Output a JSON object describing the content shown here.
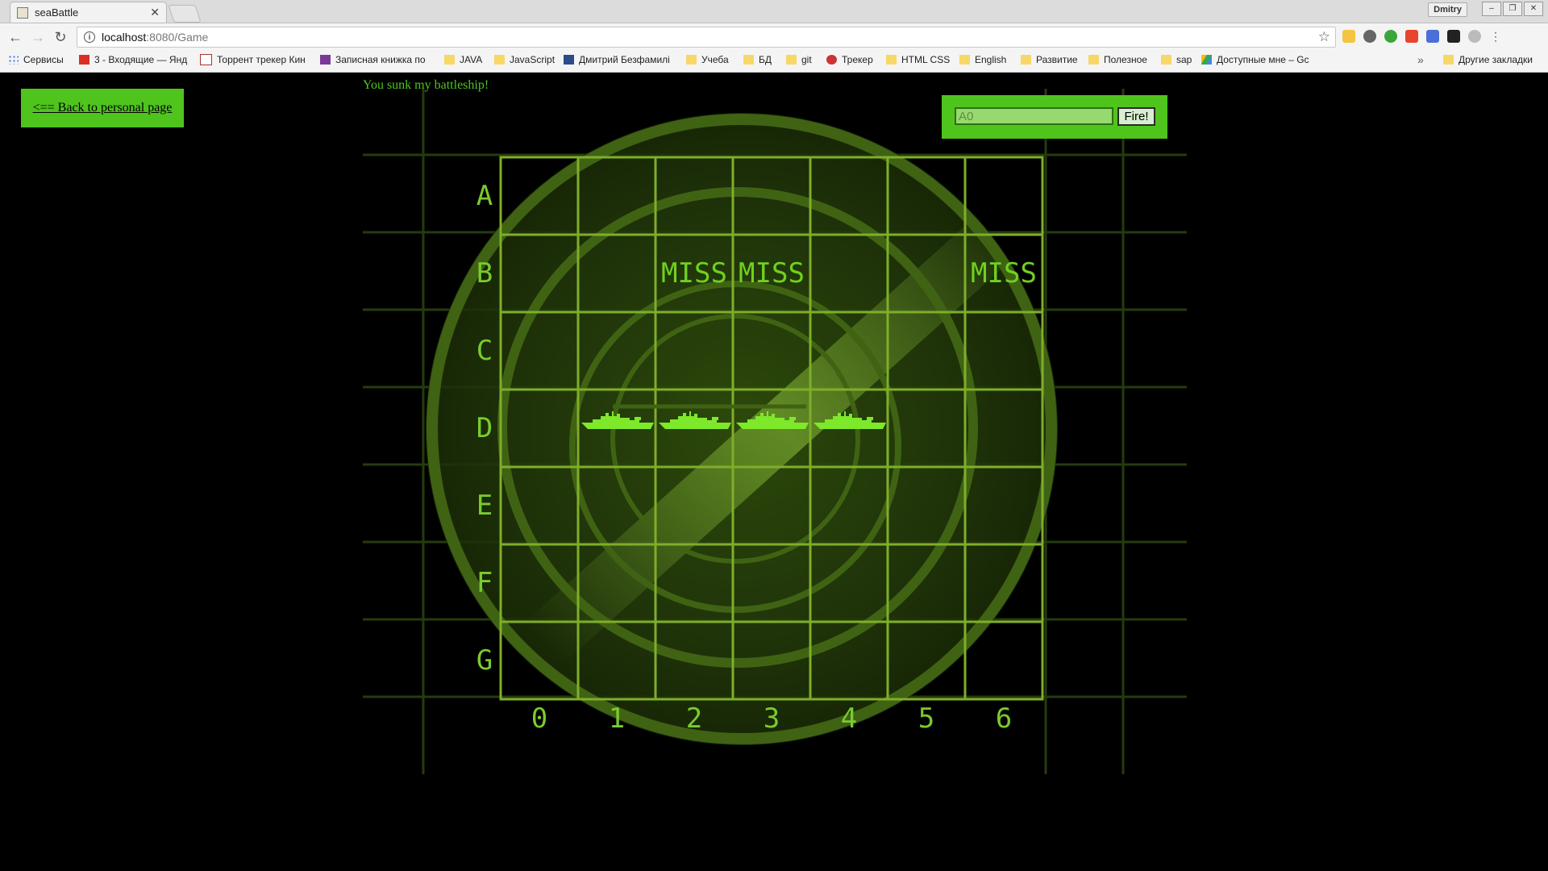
{
  "browser": {
    "tab_title": "seaBattle",
    "tab_close": "✕",
    "profile": "Dmitry",
    "url_host": "localhost",
    "url_rest": ":8080/Game",
    "bookmarks": [
      "Сервисы",
      "3 - Входящие — Янд",
      "Торрент трекер Кин",
      "Записная книжка по",
      "JAVA",
      "JavaScript",
      "Дмитрий Безфамилі",
      "Учеба",
      "БД",
      "git",
      "Трекер",
      "HTML CSS",
      "English",
      "Развитие",
      "Полезное",
      "sap",
      "Доступные мне – Gc"
    ],
    "other_bookmarks": "Другие закладки",
    "more": "»"
  },
  "page": {
    "back_link": "<== Back to personal page",
    "status_message": "You sunk my battleship!",
    "shot_placeholder": "A0",
    "fire_label": "Fire!"
  },
  "board": {
    "row_labels": [
      "A",
      "B",
      "C",
      "D",
      "E",
      "F",
      "G"
    ],
    "col_labels": [
      "0",
      "1",
      "2",
      "3",
      "4",
      "5",
      "6"
    ],
    "misses": [
      {
        "row": 1,
        "col": 2,
        "label": "MISS"
      },
      {
        "row": 1,
        "col": 3,
        "label": "MISS"
      },
      {
        "row": 1,
        "col": 6,
        "label": "MISS"
      }
    ],
    "sunk_ship": {
      "row": 3,
      "cols": [
        1,
        2,
        3,
        4
      ]
    }
  },
  "colors": {
    "accent": "#4fc41d",
    "grid": "#7fae2a",
    "ship": "#7ee82a",
    "radar": "#3d5f12"
  }
}
